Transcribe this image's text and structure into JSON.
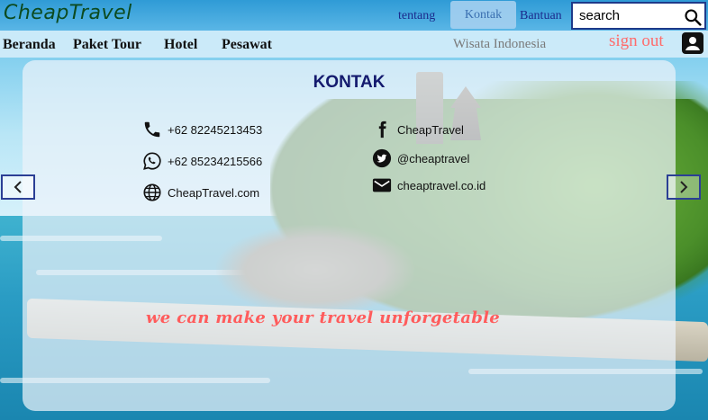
{
  "header": {
    "logo": "CheapTravel",
    "links": {
      "tentang": "tentang",
      "kontak": "Kontak",
      "bantuan": "Bantuan"
    },
    "search": {
      "value": "search",
      "icon": "search-icon"
    }
  },
  "nav": {
    "items": [
      "Beranda",
      "Paket Tour",
      "Hotel",
      "Pesawat"
    ],
    "wisata": "Wisata Indonesia",
    "signout": "sign out",
    "user_icon": "user-icon"
  },
  "card": {
    "title": "KONTAK",
    "contacts_left": [
      {
        "icon": "phone-icon",
        "text": "+62 82245213453"
      },
      {
        "icon": "whatsapp-icon",
        "text": "+62 85234215566"
      },
      {
        "icon": "globe-icon",
        "text": "CheapTravel.com"
      }
    ],
    "contacts_right": [
      {
        "icon": "facebook-icon",
        "text": "CheapTravel"
      },
      {
        "icon": "twitter-icon",
        "text": "@cheaptravel"
      },
      {
        "icon": "mail-icon",
        "text": "cheaptravel.co.id"
      }
    ],
    "tagline": "we can make your travel unforgetable"
  },
  "carousel": {
    "prev_icon": "chevron-left-icon",
    "next_icon": "chevron-right-icon"
  },
  "colors": {
    "header": "#2f9bd6",
    "logo": "#0c4a1f",
    "signout": "#ff6b6b",
    "tagline": "#ff5c5c",
    "title": "#141a6e"
  }
}
